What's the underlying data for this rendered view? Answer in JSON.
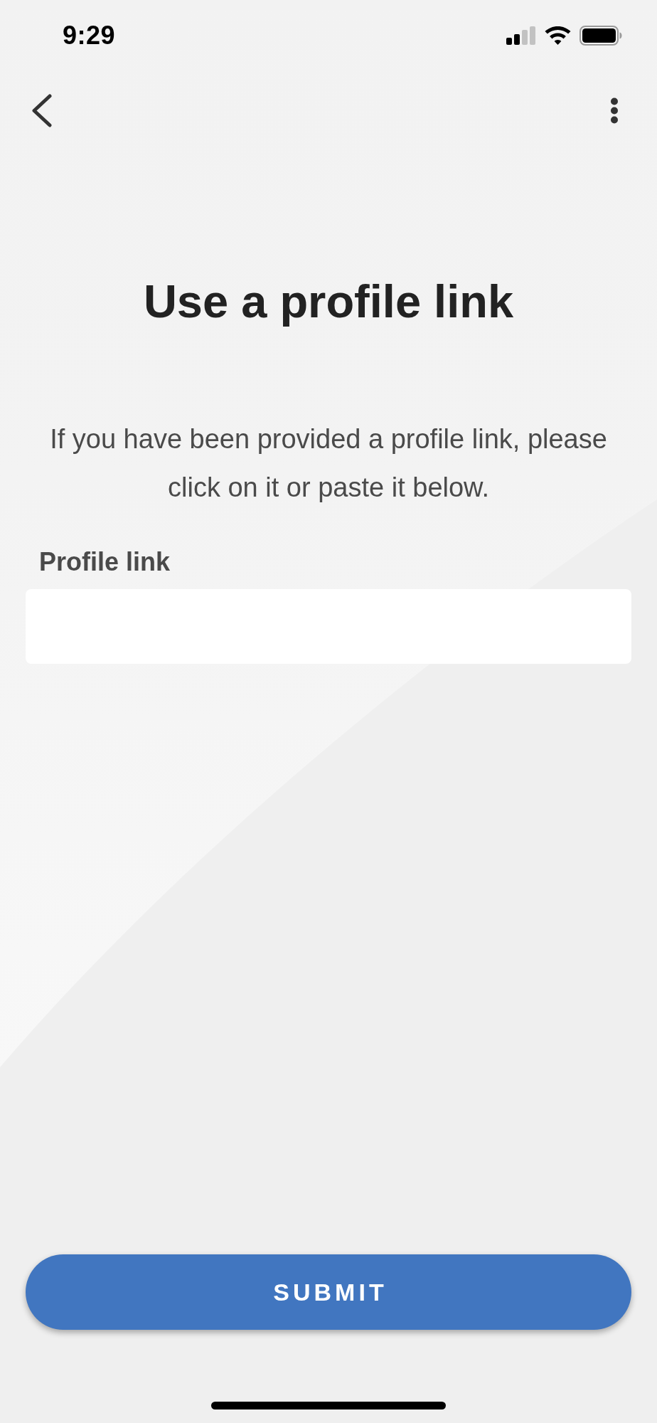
{
  "status_bar": {
    "time": "9:29"
  },
  "title": "Use a profile link",
  "description": "If you have been provided a profile link, please click on it or paste it below.",
  "profile_link_field": {
    "label": "Profile link"
  },
  "submit_button": {
    "label": "SUBMIT"
  }
}
